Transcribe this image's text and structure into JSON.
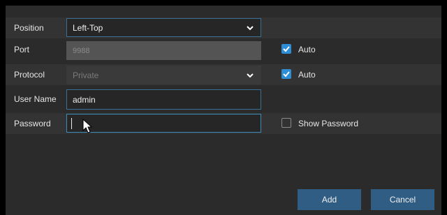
{
  "form": {
    "position": {
      "label": "Position",
      "value": "Left-Top"
    },
    "port": {
      "label": "Port",
      "value": "9988",
      "auto_checked": true,
      "auto_label": "Auto"
    },
    "protocol": {
      "label": "Protocol",
      "value": "Private",
      "auto_checked": true,
      "auto_label": "Auto"
    },
    "username": {
      "label": "User Name",
      "value": "admin"
    },
    "password": {
      "label": "Password",
      "value": "",
      "show_label": "Show Password",
      "show_checked": false
    }
  },
  "buttons": {
    "add": "Add",
    "cancel": "Cancel"
  },
  "colors": {
    "accent": "#2d8ed6",
    "button": "#2f5d84",
    "field_border": "#3b6f93",
    "panel": "#2b2b2b"
  },
  "icons": {
    "dropdown": "chevron-down-icon",
    "cursor": "mouse-pointer-icon"
  }
}
